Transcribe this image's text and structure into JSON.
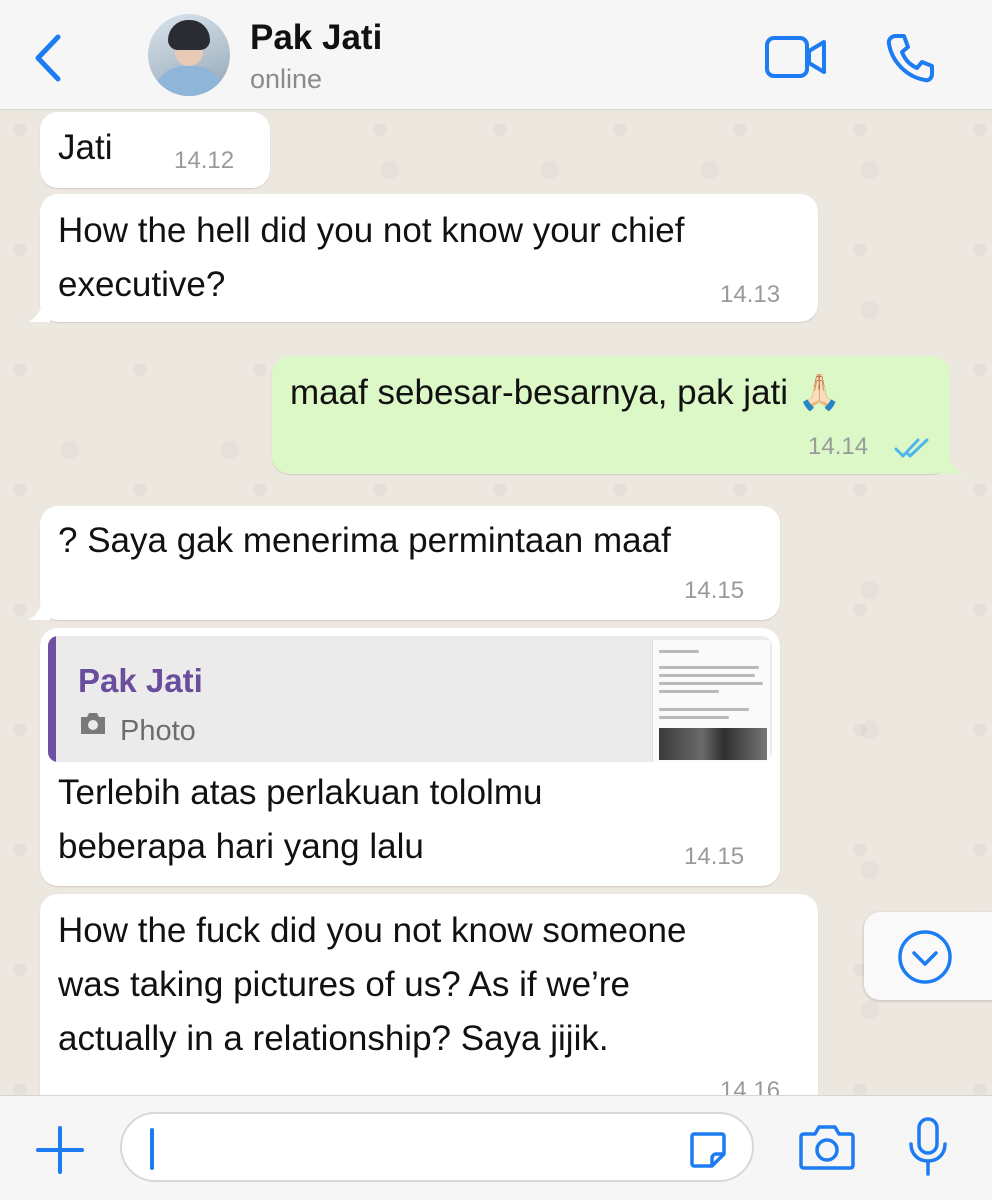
{
  "header": {
    "contact_name": "Pak Jati",
    "status": "online"
  },
  "messages": [
    {
      "direction": "in",
      "text": "Jati",
      "time": "14.12"
    },
    {
      "direction": "in",
      "lines": [
        "How the hell did you not know your chief",
        "executive?"
      ],
      "time": "14.13"
    },
    {
      "direction": "out",
      "text": "maaf sebesar-besarnya, pak jati 🙏🏻",
      "time": "14.14",
      "read": true
    },
    {
      "direction": "in",
      "text": "? Saya gak menerima permintaan maaf",
      "time": "14.15"
    },
    {
      "direction": "in",
      "reply": {
        "name": "Pak Jati",
        "type_label": "Photo"
      },
      "lines": [
        "Terlebih atas perlakuan tololmu",
        "beberapa hari yang lalu"
      ],
      "time": "14.15"
    },
    {
      "direction": "in",
      "lines": [
        "How the fuck did you not know someone",
        "was taking pictures of us? As if we’re",
        "actually in a relationship? Saya jijik."
      ],
      "time": "14.16"
    }
  ],
  "colors": {
    "accent": "#1d7cf2",
    "outgoing_bubble": "#dcf8c6",
    "incoming_bubble": "#ffffff",
    "read_ticks": "#4fb6ec",
    "reply_name": "#6a4e9d"
  },
  "icons": {
    "back": "chevron-left-icon",
    "video": "video-camera-icon",
    "call": "phone-icon",
    "scroll": "chevron-down-circle-icon",
    "attach": "plus-icon",
    "sticker": "sticker-icon",
    "camera": "camera-icon",
    "mic": "microphone-icon"
  }
}
